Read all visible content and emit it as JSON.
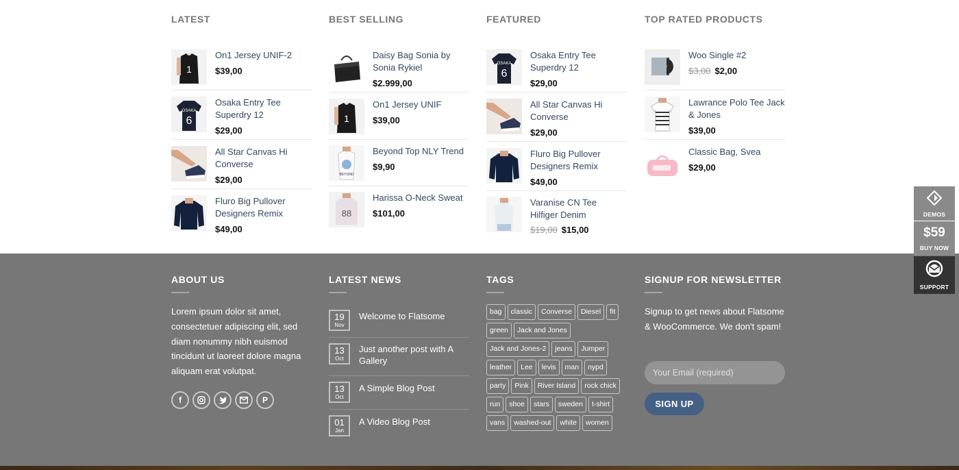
{
  "widgets": {
    "latest": {
      "title": "LATEST",
      "items": [
        {
          "name": "On1 Jersey UNIF-2",
          "price": "$39,00"
        },
        {
          "name": "Osaka Entry Tee Superdry 12",
          "price": "$29,00"
        },
        {
          "name": "All Star Canvas Hi Converse",
          "price": "$29,00"
        },
        {
          "name": "Fluro Big Pullover Designers Remix",
          "price": "$49,00"
        }
      ]
    },
    "best_selling": {
      "title": "BEST SELLING",
      "items": [
        {
          "name": "Daisy Bag Sonia by Sonia Rykiel",
          "price": "$2.999,00"
        },
        {
          "name": "On1 Jersey UNIF",
          "price": "$39,00"
        },
        {
          "name": "Beyond Top NLY Trend",
          "price": "$9,90"
        },
        {
          "name": "Harissa O-Neck Sweat",
          "price": "$101,00"
        }
      ]
    },
    "featured": {
      "title": "FEATURED",
      "items": [
        {
          "name": "Osaka Entry Tee Superdry 12",
          "price": "$29,00"
        },
        {
          "name": "All Star Canvas Hi Converse",
          "price": "$29,00"
        },
        {
          "name": "Fluro Big Pullover Designers Remix",
          "price": "$49,00"
        },
        {
          "name": "Varanise CN Tee Hilfiger Denim",
          "old_price": "$19,00",
          "price": "$15,00"
        }
      ]
    },
    "top_rated": {
      "title": "TOP RATED PRODUCTS",
      "items": [
        {
          "name": "Woo Single #2",
          "old_price": "$3,00",
          "price": "$2,00"
        },
        {
          "name": "Lawrance Polo Tee Jack & Jones",
          "price": "$39,00"
        },
        {
          "name": "Classic Bag, Svea",
          "price": "$29,00"
        }
      ]
    }
  },
  "footer": {
    "about": {
      "title": "ABOUT US",
      "text": "Lorem ipsum dolor sit amet, consectetuer adipiscing elit, sed diam nonummy nibh euismod tincidunt ut laoreet dolore magna aliquam erat volutpat."
    },
    "news": {
      "title": "LATEST NEWS",
      "posts": [
        {
          "day": "19",
          "month": "Nov",
          "title": "Welcome to Flatsome"
        },
        {
          "day": "13",
          "month": "Oct",
          "title": "Just another post with A Gallery"
        },
        {
          "day": "13",
          "month": "Oct",
          "title": "A Simple Blog Post"
        },
        {
          "day": "01",
          "month": "Jan",
          "title": "A Video Blog Post"
        }
      ]
    },
    "tags": {
      "title": "TAGS",
      "items": [
        "bag",
        "classic",
        "Converse",
        "Diesel",
        "fit",
        "green",
        "Jack and Jones",
        "Jack and Jones-2",
        "jeans",
        "Jumper",
        "leather",
        "Lee",
        "levis",
        "man",
        "nypd",
        "party",
        "Pink",
        "River Island",
        "rock chick",
        "run",
        "shoe",
        "stars",
        "sweden",
        "t-shirt",
        "vans",
        "washed-out",
        "white",
        "women"
      ]
    },
    "newsletter": {
      "title": "SIGNUP FOR NEWSLETTER",
      "text": "Signup to get news about Flatsome & WooCommerce. We don't spam!",
      "placeholder": "Your Email (required)",
      "button": "SIGN UP"
    }
  },
  "side_buttons": {
    "demos": "DEMOS",
    "price": "$59",
    "buy": "BUY NOW",
    "support": "SUPPORT"
  },
  "colors": {
    "link": "#334862",
    "footer_bg": "#777777",
    "button": "#446084",
    "side_bg": "#8a8a8a",
    "side_dark": "#333333"
  }
}
